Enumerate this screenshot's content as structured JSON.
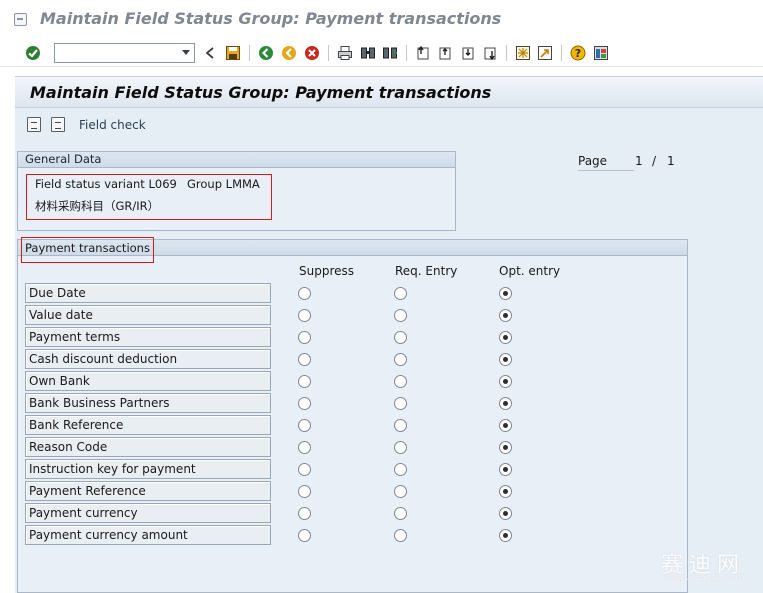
{
  "window": {
    "title": "Maintain Field Status Group: Payment transactions"
  },
  "toolbar": {
    "command_field": {
      "value": "",
      "placeholder": ""
    },
    "icons": [
      "enter-icon",
      "back-nav-icon",
      "save-icon",
      "back-icon",
      "exit-icon",
      "cancel-icon",
      "print-icon",
      "find-icon",
      "find-next-icon",
      "first-page-icon",
      "previous-page-icon",
      "next-page-icon",
      "last-page-icon",
      "create-session-icon",
      "shortcut-icon",
      "help-icon",
      "layout-menu-icon"
    ]
  },
  "screen": {
    "title": "Maintain Field Status Group: Payment transactions",
    "app_toolbar": {
      "field_check": "Field check"
    }
  },
  "general_data": {
    "header": "General Data",
    "field_status_variant": "Field status variant L069",
    "group": "Group LMMA",
    "description": "材料采购科目（GR/IR）"
  },
  "paging": {
    "label": "Page",
    "current": "1",
    "separator": "/",
    "total": "1"
  },
  "payment_transactions": {
    "header": "Payment transactions",
    "columns": [
      "Suppress",
      "Req. Entry",
      "Opt. entry"
    ],
    "rows": [
      {
        "label": "Due Date",
        "selected": "Opt. entry"
      },
      {
        "label": "Value date",
        "selected": "Opt. entry"
      },
      {
        "label": "Payment terms",
        "selected": "Opt. entry"
      },
      {
        "label": "Cash discount deduction",
        "selected": "Opt. entry"
      },
      {
        "label": "Own Bank",
        "selected": "Opt. entry"
      },
      {
        "label": "Bank Business Partners",
        "selected": "Opt. entry"
      },
      {
        "label": "Bank Reference",
        "selected": "Opt. entry"
      },
      {
        "label": "Reason Code",
        "selected": "Opt. entry"
      },
      {
        "label": "Instruction key for payment",
        "selected": "Opt. entry"
      },
      {
        "label": "Payment Reference",
        "selected": "Opt. entry"
      },
      {
        "label": "Payment currency",
        "selected": "Opt. entry"
      },
      {
        "label": "Payment currency amount",
        "selected": "Opt. entry"
      }
    ]
  },
  "watermark": {
    "text": "赛迪网",
    "subtext": "www.315sap.com"
  },
  "colors": {
    "screen_bg": "#e6eef5",
    "highlight": "#d01c1c",
    "title_gray": "#7f8793"
  }
}
